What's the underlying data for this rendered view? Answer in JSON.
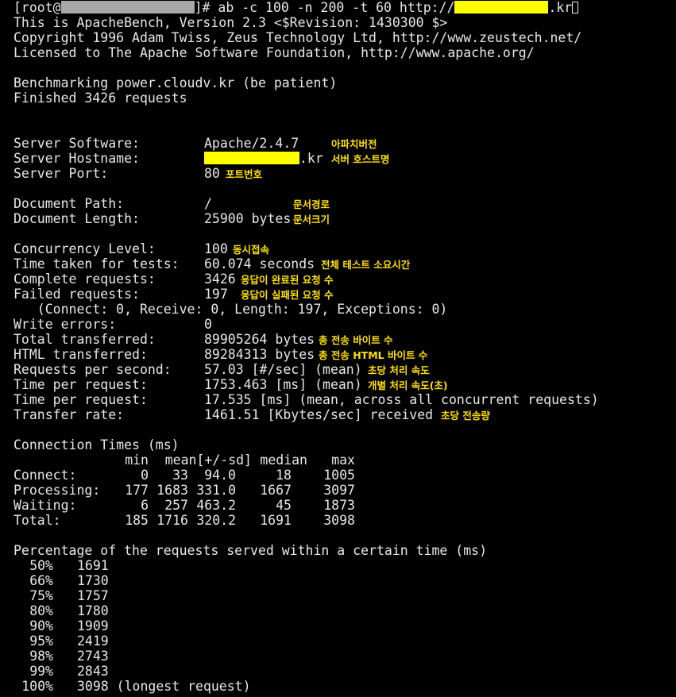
{
  "command": {
    "prefix": "[root@",
    "prompt_end": "]# ab -c 100 -n 200 -t 60 http://",
    "url_suffix": ".kr"
  },
  "intro": [
    "This is ApacheBench, Version 2.3 <$Revision: 1430300 $>",
    "Copyright 1996 Adam Twiss, Zeus Technology Ltd, http://www.zeustech.net/",
    "Licensed to The Apache Software Foundation, http://www.apache.org/"
  ],
  "status": [
    "Benchmarking power.cloudv.kr (be patient)",
    "Finished 3426 requests"
  ],
  "server": {
    "software_label": "Server Software:",
    "software_value": "Apache/2.4.7",
    "software_note": "아파치버전",
    "hostname_label": "Server Hostname:",
    "hostname_suffix": ".kr",
    "hostname_note": "서버 호스트명",
    "port_label": "Server Port:",
    "port_value": "80",
    "port_note": "포트번호"
  },
  "document": {
    "path_label": "Document Path:",
    "path_value": "/",
    "path_note": "문서경로",
    "length_label": "Document Length:",
    "length_value": "25900 bytes",
    "length_note": "문서크기"
  },
  "stats": [
    {
      "label": "Concurrency Level:",
      "value": "100",
      "note": "동시접속"
    },
    {
      "label": "Time taken for tests:",
      "value": "60.074 seconds",
      "note": "전체 테스트 소요시간"
    },
    {
      "label": "Complete requests:",
      "value": "3426",
      "note": "응답이 완료된 요청 수"
    },
    {
      "label": "Failed requests:",
      "value": "197",
      "note": "응답이 실패된 요청 수"
    }
  ],
  "failed_detail": "   (Connect: 0, Receive: 0, Length: 197, Exceptions: 0)",
  "stats2": [
    {
      "label": "Write errors:",
      "value": "0",
      "note": ""
    },
    {
      "label": "Total transferred:",
      "value": "89905264 bytes",
      "note": "총 전송 바이트 수"
    },
    {
      "label": "HTML transferred:",
      "value": "89284313 bytes",
      "note": "총 전송 HTML 바이트 수"
    },
    {
      "label": "Requests per second:",
      "value": "57.03 [#/sec] (mean)",
      "note": "초당 처리 속도"
    },
    {
      "label": "Time per request:",
      "value": "1753.463 [ms] (mean)",
      "note": "개별 처리 속도(초)"
    },
    {
      "label": "Time per request:",
      "value": "17.535 [ms] (mean, across all concurrent requests)",
      "note": ""
    },
    {
      "label": "Transfer rate:",
      "value": "1461.51 [Kbytes/sec] received",
      "note": "초당 전송량"
    }
  ],
  "connection_times": {
    "title": "Connection Times (ms)",
    "headers": [
      "min",
      "mean[+/-sd]",
      "median",
      "max"
    ],
    "rows": [
      {
        "label": "Connect:",
        "min": "0",
        "mean": "33",
        "sd": "94.0",
        "median": "18",
        "max": "1005"
      },
      {
        "label": "Processing:",
        "min": "177",
        "mean": "1683",
        "sd": "331.0",
        "median": "1667",
        "max": "3097"
      },
      {
        "label": "Waiting:",
        "min": "6",
        "mean": "257",
        "sd": "463.2",
        "median": "45",
        "max": "1873"
      },
      {
        "label": "Total:",
        "min": "185",
        "mean": "1716",
        "sd": "320.2",
        "median": "1691",
        "max": "3098"
      }
    ]
  },
  "percentiles": {
    "title": "Percentage of the requests served within a certain time (ms)",
    "rows": [
      {
        "pct": "50%",
        "ms": "1691"
      },
      {
        "pct": "66%",
        "ms": "1730"
      },
      {
        "pct": "75%",
        "ms": "1757"
      },
      {
        "pct": "80%",
        "ms": "1780"
      },
      {
        "pct": "90%",
        "ms": "1909"
      },
      {
        "pct": "95%",
        "ms": "2419"
      },
      {
        "pct": "98%",
        "ms": "2743"
      },
      {
        "pct": "99%",
        "ms": "2843"
      },
      {
        "pct": "100%",
        "ms": "3098 (longest request)"
      }
    ]
  }
}
